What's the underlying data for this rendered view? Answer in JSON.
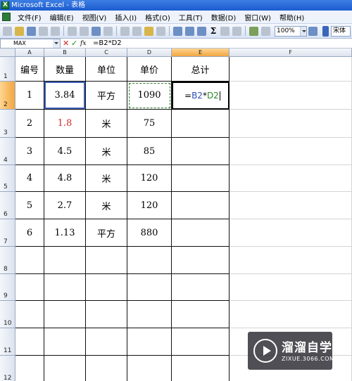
{
  "window": {
    "title": "Microsoft Excel - 表格"
  },
  "menu": [
    "文件(F)",
    "编辑(E)",
    "视图(V)",
    "插入(I)",
    "格式(O)",
    "工具(T)",
    "数据(D)",
    "窗口(W)",
    "帮助(H)"
  ],
  "toolbar": {
    "zoom": "100%",
    "font": "宋体",
    "sigma": "Σ"
  },
  "formula_bar": {
    "name_box": "MAX",
    "cancel": "✕",
    "enter": "✓",
    "insert_function": "fx",
    "formula": "=B2*D2"
  },
  "columns": [
    "A",
    "B",
    "C",
    "D",
    "E",
    "F"
  ],
  "rows": [
    "1",
    "2",
    "3",
    "4",
    "5",
    "6",
    "7",
    "8",
    "9",
    "10",
    "11",
    "12"
  ],
  "table": {
    "header": [
      "编号",
      "数量",
      "单位",
      "单价",
      "总计"
    ],
    "rows": [
      [
        "1",
        "3.84",
        "平方",
        "1090"
      ],
      [
        "2",
        "1.8",
        "米",
        "75"
      ],
      [
        "3",
        "4.5",
        "米",
        "85"
      ],
      [
        "4",
        "4.8",
        "米",
        "120"
      ],
      [
        "5",
        "2.7",
        "米",
        "120"
      ],
      [
        "6",
        "1.13",
        "平方",
        "880"
      ]
    ],
    "editing_cell": {
      "eq": "=",
      "ref1": "B2",
      "op": "*",
      "ref2": "D2"
    }
  },
  "colors": {
    "red_value": "#d42a2a",
    "active_header": "#f2a63e",
    "ref_blue": "#2d4fb4",
    "ref_green": "#2a8a2a"
  },
  "watermark": {
    "name": "溜溜自学",
    "site": "ZIXUE.3066.COM"
  }
}
